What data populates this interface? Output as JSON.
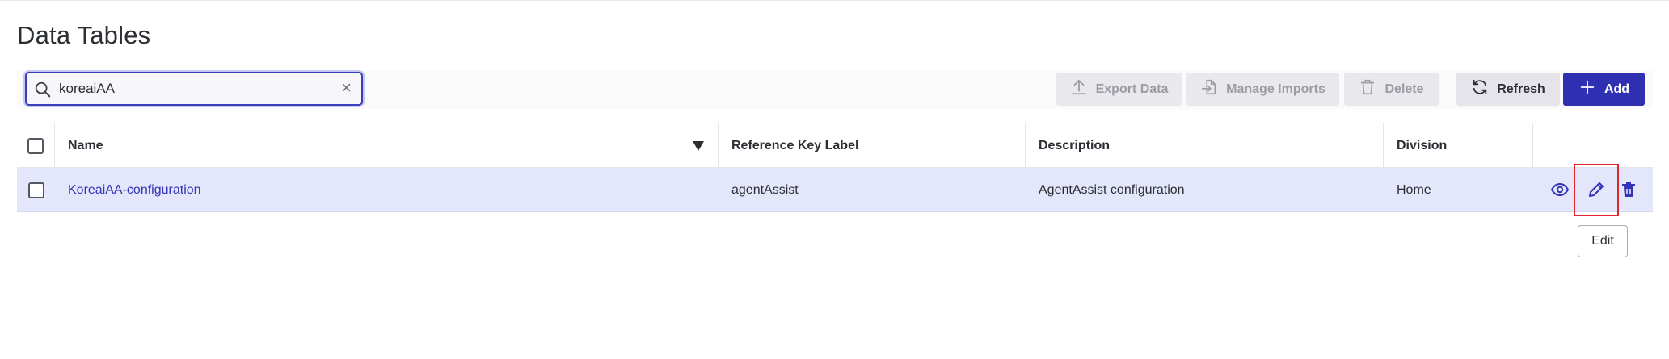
{
  "page": {
    "title": "Data Tables"
  },
  "search": {
    "value": "koreaiAA",
    "clear_icon": "×"
  },
  "toolbar": {
    "export_label": "Export Data",
    "manage_label": "Manage Imports",
    "delete_label": "Delete",
    "refresh_label": "Refresh",
    "add_label": "Add"
  },
  "table": {
    "headers": [
      "Name",
      "Reference Key Label",
      "Description",
      "Division"
    ],
    "rows": [
      {
        "name": "KoreaiAA-configuration",
        "reference_key_label": "agentAssist",
        "description": "AgentAssist configuration",
        "division": "Home"
      }
    ]
  },
  "tooltip": {
    "text": "Edit"
  },
  "colors": {
    "accent": "#2f2fb2",
    "row_selected": "#e4e6fb",
    "highlight": "#e0262b"
  },
  "icons": [
    "search-icon",
    "close-icon",
    "upload-icon",
    "import-icon",
    "trash-icon",
    "refresh-icon",
    "plus-icon",
    "sort-down-icon",
    "eye-icon",
    "pencil-icon"
  ]
}
